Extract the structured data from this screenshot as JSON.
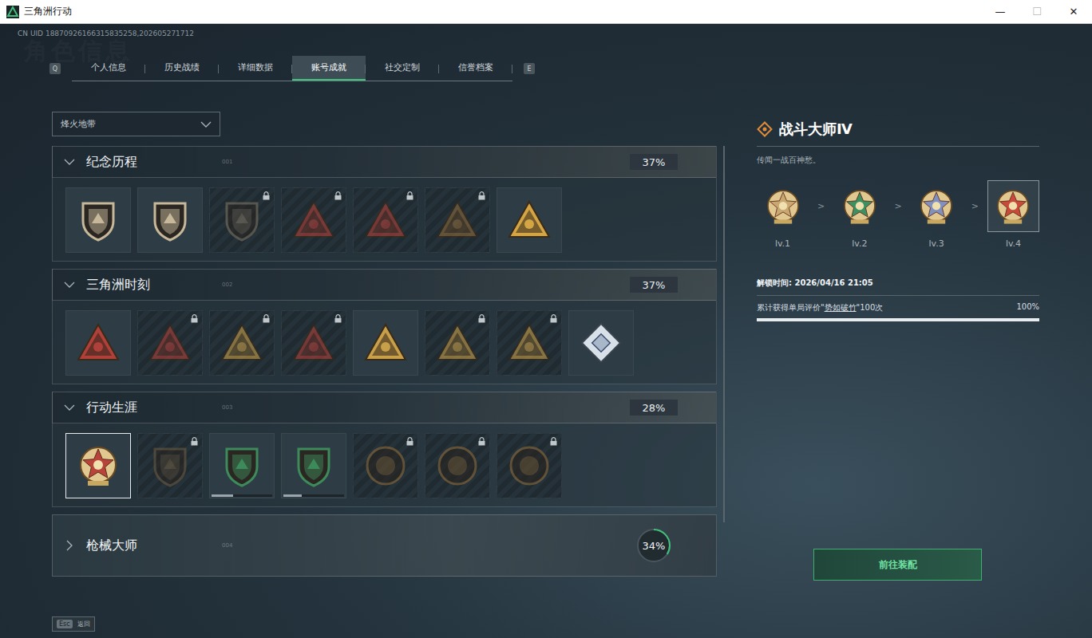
{
  "window": {
    "title": "三角洲行动",
    "controls": [
      {
        "glyph": "—",
        "disabled": false
      },
      {
        "glyph": "☐",
        "disabled": true
      },
      {
        "glyph": "✕",
        "disabled": false
      }
    ]
  },
  "uid": "CN UID 18870926166315835258,202605271712",
  "watermark": "角色信息",
  "tabs": {
    "prev_key": "Q",
    "next_key": "E",
    "items": [
      {
        "label": "个人信息",
        "selected": false
      },
      {
        "label": "历史战绩",
        "selected": false
      },
      {
        "label": "详细数据",
        "selected": false
      },
      {
        "label": "账号成就",
        "selected": true
      },
      {
        "label": "社交定制",
        "selected": false
      },
      {
        "label": "信誉档案",
        "selected": false
      }
    ]
  },
  "mode_select": {
    "value": "烽火地带",
    "expanded": false
  },
  "sections": [
    {
      "title": "纪念历程",
      "number": "001",
      "percent": "37%",
      "expanded": true,
      "badges": [
        {
          "kind": "shield",
          "color": "#c8b89a",
          "locked": false,
          "selected": false
        },
        {
          "kind": "shield",
          "color": "#c8b89a",
          "locked": false,
          "selected": false
        },
        {
          "kind": "shield",
          "color": "#7a7060",
          "locked": true,
          "selected": false
        },
        {
          "kind": "triangle",
          "color": "#b0413a",
          "locked": true,
          "selected": false
        },
        {
          "kind": "triangle",
          "color": "#b0413a",
          "locked": true,
          "selected": false
        },
        {
          "kind": "triangle",
          "color": "#8a6a3a",
          "locked": true,
          "selected": false
        },
        {
          "kind": "triangle",
          "color": "#d4a545",
          "locked": false,
          "selected": false
        }
      ]
    },
    {
      "title": "三角洲时刻",
      "number": "002",
      "percent": "37%",
      "expanded": true,
      "badges": [
        {
          "kind": "triangle",
          "color": "#b0413a",
          "locked": false,
          "selected": false
        },
        {
          "kind": "triangle",
          "color": "#b0413a",
          "locked": true,
          "selected": false
        },
        {
          "kind": "triangle",
          "color": "#c9a04a",
          "locked": true,
          "selected": false
        },
        {
          "kind": "triangle",
          "color": "#b0413a",
          "locked": true,
          "selected": false
        },
        {
          "kind": "triangle",
          "color": "#c9a04a",
          "locked": false,
          "selected": false
        },
        {
          "kind": "triangle",
          "color": "#c9a04a",
          "locked": true,
          "selected": false
        },
        {
          "kind": "triangle",
          "color": "#c9a04a",
          "locked": true,
          "selected": false
        },
        {
          "kind": "diamond",
          "color": "#a8b8c8",
          "locked": false,
          "selected": false
        }
      ]
    },
    {
      "title": "行动生涯",
      "number": "003",
      "percent": "28%",
      "expanded": true,
      "badges": [
        {
          "kind": "medal",
          "color": "#b8433a",
          "locked": false,
          "selected": true
        },
        {
          "kind": "shield",
          "color": "#6a5a40",
          "locked": true,
          "selected": false
        },
        {
          "kind": "shield",
          "color": "#3d8a5a",
          "locked": false,
          "selected": false,
          "level": 0.35
        },
        {
          "kind": "shield",
          "color": "#3d8a5a",
          "locked": false,
          "selected": false,
          "level": 0.3
        },
        {
          "kind": "circle",
          "color": "#8a6a3a",
          "locked": true,
          "selected": false
        },
        {
          "kind": "circle",
          "color": "#8a6a3a",
          "locked": true,
          "selected": false
        },
        {
          "kind": "circle",
          "color": "#8a6a3a",
          "locked": true,
          "selected": false
        }
      ]
    },
    {
      "title": "枪械大师",
      "number": "004",
      "percent": "34%",
      "expanded": false,
      "level": 0.34,
      "badges": []
    }
  ],
  "detail": {
    "title": "战斗大师Ⅳ",
    "description": "传闻一战百神愁。",
    "levels": [
      {
        "label": "lv.1",
        "color": "#c8a870",
        "selected": false
      },
      {
        "label": "lv.2",
        "color": "#3d9060",
        "selected": false
      },
      {
        "label": "lv.3",
        "color": "#8090c0",
        "selected": false
      },
      {
        "label": "lv.4",
        "color": "#c84a3a",
        "selected": true
      }
    ],
    "separator": ">",
    "unlock_label": "解锁时间: ",
    "unlock_time": "2026/04/16 21:05",
    "requirement": [
      {
        "text": "累计获得单局评价\"",
        "underline": false
      },
      {
        "text": "势如破竹",
        "underline": true
      },
      {
        "text": "\"100次",
        "underline": false
      }
    ],
    "requirement_percent": "100%",
    "requirement_level": 1,
    "button": "前往装配"
  },
  "footer": {
    "key": "Esc",
    "label": "返回"
  }
}
